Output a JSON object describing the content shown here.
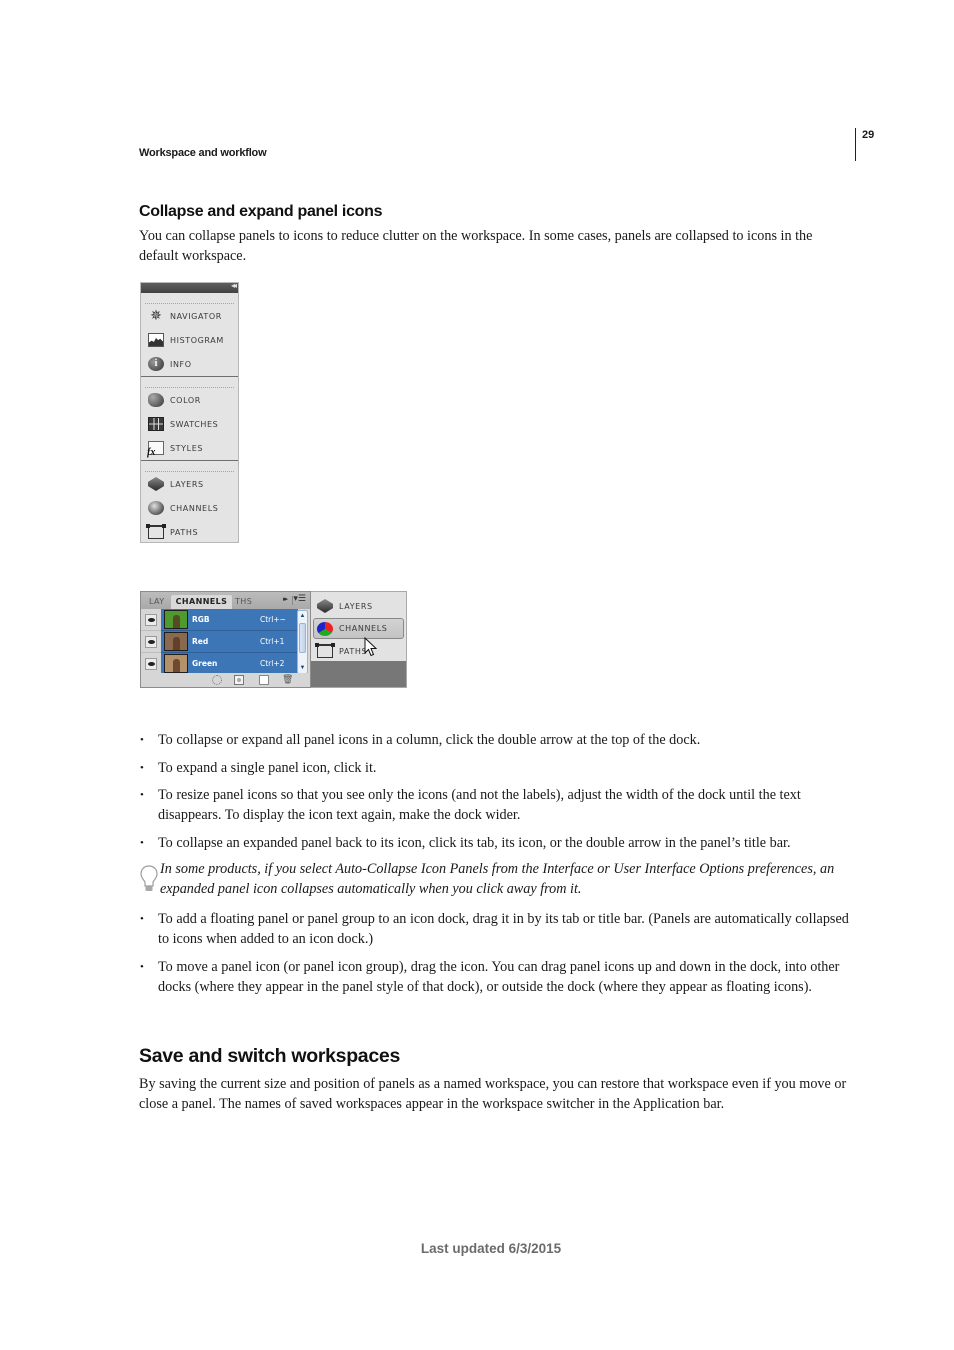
{
  "header": {
    "running_head": "Workspace and workflow",
    "page_number": "29"
  },
  "section1": {
    "heading": "Collapse and expand panel icons",
    "intro": "You can collapse panels to icons to reduce clutter on the workspace. In some cases, panels are collapsed to icons in the default workspace."
  },
  "figure1": {
    "collapse_glyph": "◂◂",
    "groups": [
      {
        "items": [
          {
            "icon": "navigator-icon",
            "label": "NAVIGATOR"
          },
          {
            "icon": "histogram-icon",
            "label": "HISTOGRAM"
          },
          {
            "icon": "info-icon",
            "label": "INFO"
          }
        ]
      },
      {
        "items": [
          {
            "icon": "color-icon",
            "label": "COLOR"
          },
          {
            "icon": "swatches-icon",
            "label": "SWATCHES"
          },
          {
            "icon": "styles-icon",
            "label": "STYLES"
          }
        ]
      },
      {
        "items": [
          {
            "icon": "layers-icon",
            "label": "LAYERS"
          },
          {
            "icon": "channels-icon",
            "label": "CHANNELS"
          },
          {
            "icon": "paths-icon",
            "label": "PATHS"
          }
        ]
      }
    ]
  },
  "figure2": {
    "tabs": [
      "LAY",
      "CHANNELS",
      "THS"
    ],
    "active_tab": "CHANNELS",
    "forward_glyph": "▸▸",
    "menu_glyph": "▾☰",
    "channels": [
      {
        "name": "RGB",
        "shortcut": "Ctrl+~",
        "thumb_color": "#4f9a2e"
      },
      {
        "name": "Red",
        "shortcut": "Ctrl+1",
        "thumb_color": "#8a6a4e"
      },
      {
        "name": "Green",
        "shortcut": "Ctrl+2",
        "thumb_color": "#b3916a"
      }
    ],
    "selection_color": "#3d76b7",
    "scroll_up": "▲",
    "scroll_down": "▼",
    "trash_glyph": "🗑",
    "dock_items": [
      {
        "icon": "layers-icon",
        "label": "LAYERS"
      },
      {
        "icon": "channels-icon",
        "label": "CHANNELS",
        "active": true
      },
      {
        "icon": "paths-icon",
        "label": "PATHS"
      }
    ]
  },
  "bullets1": [
    "To collapse or expand all panel icons in a column, click the double arrow at the top of the dock.",
    "To expand a single panel icon, click it.",
    "To resize panel icons so that you see only the icons (and not the labels), adjust the width of the dock until the text disappears. To display the icon text again, make the dock wider.",
    "To collapse an expanded panel back to its icon, click its tab, its icon, or the double arrow in the panel’s title bar."
  ],
  "tip": "In some products, if you select Auto-Collapse Icon Panels from the Interface or User Interface Options preferences, an expanded panel icon collapses automatically when you click away from it.",
  "bullets2": [
    "To add a floating panel or panel group to an icon dock, drag it in by its tab or title bar. (Panels are automatically collapsed to icons when added to an icon dock.)",
    "To move a panel icon (or panel icon group), drag the icon. You can drag panel icons up and down in the dock, into other docks (where they appear in the panel style of that dock), or outside the dock (where they appear as floating icons)."
  ],
  "section2": {
    "heading": "Save and switch workspaces",
    "body": "By saving the current size and position of panels as a named workspace, you can restore that workspace even if you move or close a panel. The names of saved workspaces appear in the workspace switcher in the Application bar."
  },
  "footer": {
    "last_updated": "Last updated 6/3/2015"
  }
}
